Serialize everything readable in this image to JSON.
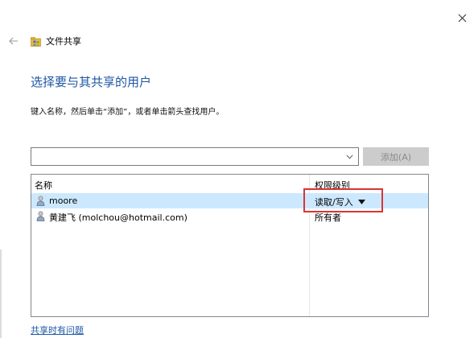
{
  "window": {
    "title": "文件共享"
  },
  "main": {
    "heading": "选择要与其共享的用户",
    "instruction": "键入名称，然后单击“添加”，或者单击箭头查找用户。",
    "combo": {
      "value": "",
      "placeholder": ""
    },
    "add_button_label": "添加(A)"
  },
  "list": {
    "headers": {
      "name": "名称",
      "permission": "权限级别"
    },
    "rows": [
      {
        "name": "moore",
        "permission": "读取/写入",
        "selected": true
      },
      {
        "name": "黄建飞 (molchou@hotmail.com)",
        "permission": "所有者",
        "selected": false
      }
    ]
  },
  "footer": {
    "help_link": "共享时有问题"
  },
  "colors": {
    "heading": "#1d56a6",
    "selection": "#cce8ff",
    "highlight_box": "#d93434",
    "disabled_button_bg": "#cccccc"
  },
  "icons": {
    "close": "close-icon",
    "back": "back-arrow-icon",
    "app": "file-sharing-icon",
    "user": "user-icon",
    "dropdown": "chevron-down-icon",
    "permission_dropdown": "triangle-down-icon"
  }
}
